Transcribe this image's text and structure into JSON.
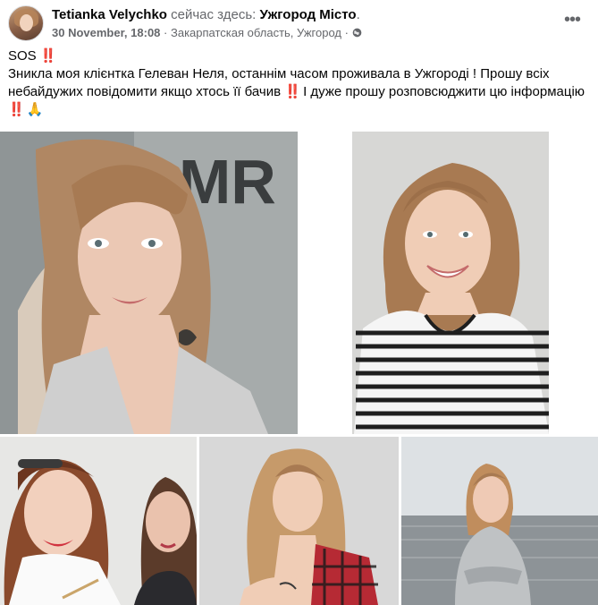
{
  "post": {
    "author": "Tetianka Velychko",
    "verb": "сейчас здесь:",
    "place": "Ужгород Місто",
    "place_suffix": ".",
    "date": "30 November, 18:08",
    "location": "Закарпатская область, Ужгород",
    "separator": "·",
    "audience_icon": "globe-icon",
    "more_icon": "more-options-icon",
    "more_glyph": "•••",
    "text_line1": "SOS",
    "text_line2": "Зникла моя клієнтка Гелеван Неля, останнім часом проживала в Ужгороді ! Прошу всіх небайдужих повідомити якщо хтось її бачив",
    "text_line2_end": "І дуже прошу розповсюджити цю інформацію",
    "emoji_bang": "‼️",
    "emoji_pray": "🙏"
  },
  "photos": [
    {
      "name": "photo-1",
      "icon": "photo-selfie"
    },
    {
      "name": "photo-2",
      "icon": "photo-striped-shirt"
    },
    {
      "name": "photo-3",
      "icon": "photo-two-women"
    },
    {
      "name": "photo-4",
      "icon": "photo-plaid-shirt"
    },
    {
      "name": "photo-5",
      "icon": "photo-seaside"
    }
  ],
  "colors": {
    "text": "#050505",
    "secondary": "#65676b",
    "alert": "#e41e3f"
  }
}
